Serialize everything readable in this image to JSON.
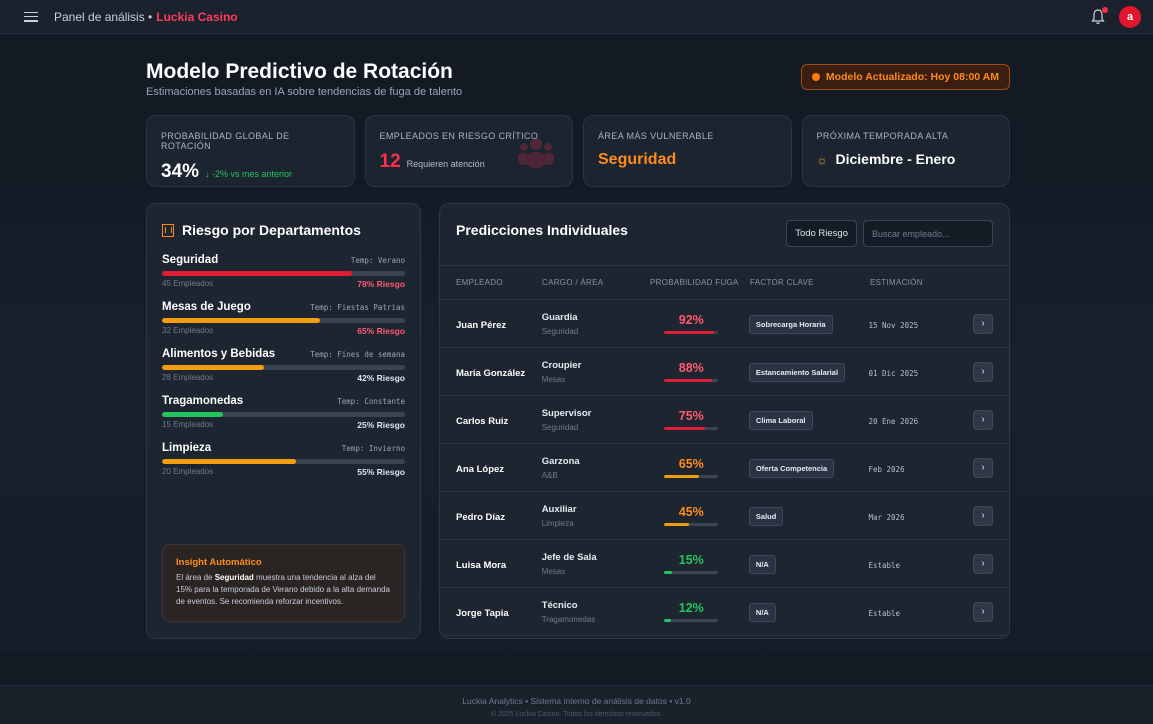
{
  "topbar": {
    "title": "Panel de análisis •",
    "brand": "Luckia Casino",
    "avatar_letter": "a"
  },
  "header": {
    "title": "Modelo Predictivo de Rotación",
    "subtitle": "Estimaciones basadas en IA sobre tendencias de fuga de talento",
    "model_badge": "Modelo Actualizado: Hoy 08:00 AM"
  },
  "kpis": {
    "global": {
      "label": "Probabilidad Global de Rotación",
      "value": "34%",
      "sub": "↓ -2% vs mes anterior"
    },
    "critical": {
      "label": "Empleados en Riesgo Crítico",
      "value": "12",
      "sub": "Requieren atención"
    },
    "vulnerable": {
      "label": "Área Más Vulnerable",
      "value": "Seguridad"
    },
    "season": {
      "label": "Próxima Temporada Alta",
      "icon": "☼",
      "value": "Diciembre - Enero"
    }
  },
  "departments": {
    "title": "Riesgo por Departamentos",
    "items": [
      {
        "name": "Seguridad",
        "temp": "Temp: Verano",
        "count": "45 Empleados",
        "risk": "78% Riesgo",
        "level": 78,
        "color": "#e11d36",
        "high": true
      },
      {
        "name": "Mesas de Juego",
        "temp": "Temp: Fiestas Patrias",
        "count": "32 Empleados",
        "risk": "65% Riesgo",
        "level": 65,
        "color": "#f59e0b",
        "high": true
      },
      {
        "name": "Alimentos y Bebidas",
        "temp": "Temp: Fines de semana",
        "count": "28 Empleados",
        "risk": "42% Riesgo",
        "level": 42,
        "color": "#f59e0b",
        "high": false
      },
      {
        "name": "Tragamonedas",
        "temp": "Temp: Constante",
        "count": "15 Empleados",
        "risk": "25% Riesgo",
        "level": 25,
        "color": "#22c55e",
        "high": false
      },
      {
        "name": "Limpieza",
        "temp": "Temp: Invierno",
        "count": "20 Empleados",
        "risk": "55% Riesgo",
        "level": 55,
        "color": "#f59e0b",
        "high": false
      }
    ],
    "insight": {
      "title": "Insight Automático",
      "pre": "El área de ",
      "bold": "Seguridad",
      "post": " muestra una tendencia al alza del 15% para la temporada de Verano debido a la alta demanda de eventos. Se recomienda reforzar incentivos."
    }
  },
  "predictions": {
    "title": "Predicciones Individuales",
    "filter_label": "Todo Riesgo",
    "search_placeholder": "Buscar empleado...",
    "columns": [
      "Empleado",
      "Cargo / Área",
      "Probabilidad Fuga",
      "Factor Clave",
      "Estimación"
    ],
    "rows": [
      {
        "name": "Juan Pérez",
        "role": "Guardia",
        "area": "Seguridad",
        "prob": "92%",
        "level": 92,
        "color": "#e11d36",
        "text_color": "#ff5a72",
        "factor": "Sobrecarga Horaria",
        "est": "15 Nov 2025"
      },
      {
        "name": "María González",
        "role": "Croupier",
        "area": "Mesas",
        "prob": "88%",
        "level": 88,
        "color": "#e11d36",
        "text_color": "#ff5a72",
        "factor": "Estancamiento Salarial",
        "est": "01 Dic 2025"
      },
      {
        "name": "Carlos Ruiz",
        "role": "Supervisor",
        "area": "Seguridad",
        "prob": "75%",
        "level": 75,
        "color": "#e11d36",
        "text_color": "#ff5a72",
        "factor": "Clima Laboral",
        "est": "20 Ene 2026"
      },
      {
        "name": "Ana López",
        "role": "Garzona",
        "area": "A&B",
        "prob": "65%",
        "level": 65,
        "color": "#f59e0b",
        "text_color": "#ff8c1a",
        "factor": "Oferta Competencia",
        "est": "Feb 2026"
      },
      {
        "name": "Pedro Díaz",
        "role": "Auxiliar",
        "area": "Limpieza",
        "prob": "45%",
        "level": 45,
        "color": "#f59e0b",
        "text_color": "#ff8c1a",
        "factor": "Salud",
        "est": "Mar 2026"
      },
      {
        "name": "Luisa Mora",
        "role": "Jefe de Sala",
        "area": "Mesas",
        "prob": "15%",
        "level": 15,
        "color": "#22c55e",
        "text_color": "#22c55e",
        "factor": "N/A",
        "est": "Estable"
      },
      {
        "name": "Jorge Tapia",
        "role": "Técnico",
        "area": "Tragamonedas",
        "prob": "12%",
        "level": 12,
        "color": "#22c55e",
        "text_color": "#22c55e",
        "factor": "N/A",
        "est": "Estable"
      }
    ]
  },
  "footer": {
    "line1": "Luckia Analytics • Sistema interno de análisis de datos • v1.0",
    "line2": "© 2025 Luckia Casino. Todos los derechos reservados."
  }
}
